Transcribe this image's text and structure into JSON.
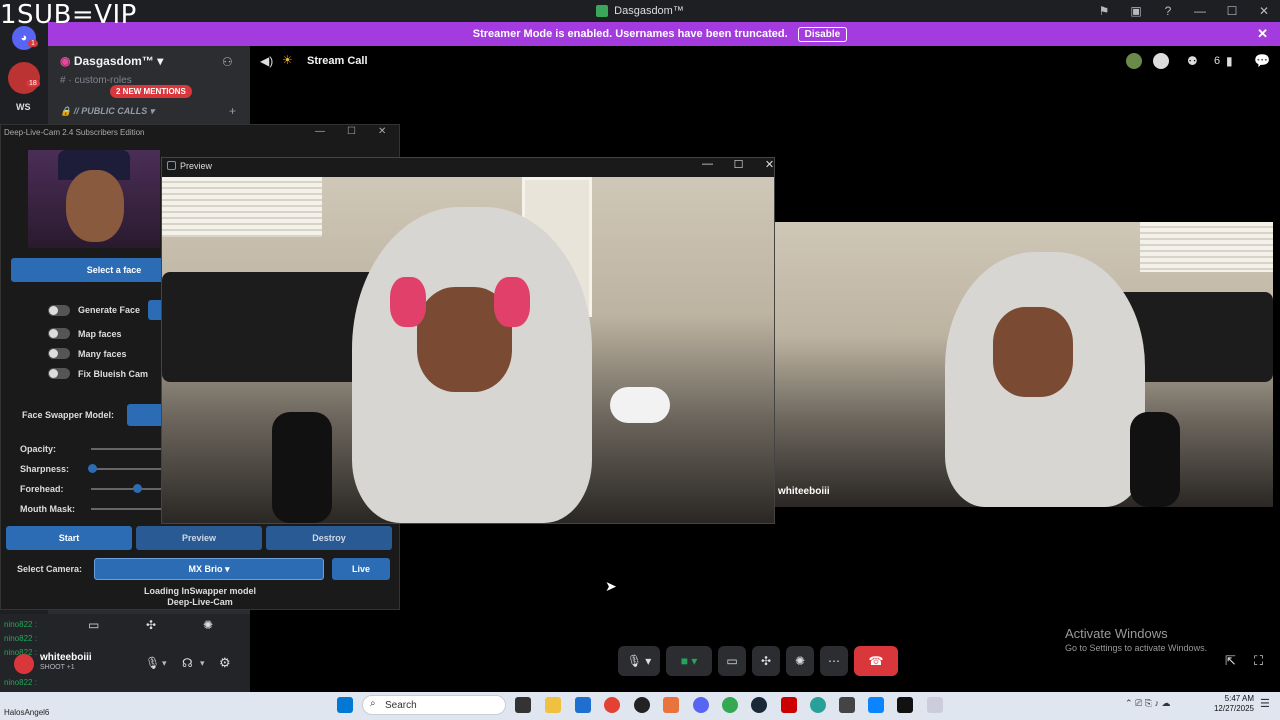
{
  "overlay_text": "1SUB=VIP",
  "discord": {
    "window_title": "Dasgasdom™",
    "banner_text": "Streamer Mode is enabled. Usernames have been truncated.",
    "banner_button": "Disable",
    "server_name": "Dasgasdom™",
    "channel_custom_roles": "custom-roles",
    "mentions_badge": "2 NEW MENTIONS",
    "category_public_calls": "// PUBLIC CALLS",
    "rail_badge_1": "1",
    "rail_badge_2": "18",
    "rail_ws": "WS",
    "stream_title": "Stream Call",
    "participant_count": "6",
    "tile_username": "whiteeboiii",
    "user_name": "whiteeboiii",
    "user_sub": "SHOOT +1",
    "chat_lines": [
      "nino822 :",
      "nino822 :",
      "nino822 :",
      "nino822 :",
      "nino822 :"
    ],
    "chat_bottom": "HalosAngel6"
  },
  "deep_live_cam": {
    "window_title": "Deep-Live-Cam 2.4 Subscribers Edition",
    "select_face": "Select a face",
    "toggles": [
      "Generate Face",
      "Map faces",
      "Many faces",
      "Fix Blueish Cam"
    ],
    "face_swapper_model_label": "Face Swapper Model:",
    "sliders": [
      "Opacity:",
      "Sharpness:",
      "Forehead:",
      "Mouth Mask:"
    ],
    "start": "Start",
    "preview": "Preview",
    "destroy": "Destroy",
    "select_camera_label": "Select Camera:",
    "camera_value": "MX Brio",
    "live": "Live",
    "status_line1": "Loading InSwapper model",
    "status_line2": "Deep-Live-Cam"
  },
  "preview_window": {
    "title": "Preview"
  },
  "windows_watermark": {
    "title": "Activate Windows",
    "subtitle": "Go to Settings to activate Windows."
  },
  "taskbar": {
    "search_placeholder": "Search",
    "time": "5:47 AM",
    "date": "12/27/2025"
  },
  "colors": {
    "banner": "#a33bdf",
    "accent_blue": "#2c6cb5",
    "hangup": "#da373c"
  }
}
